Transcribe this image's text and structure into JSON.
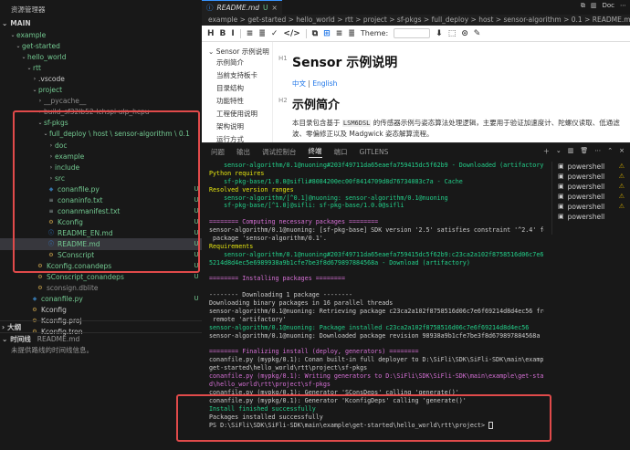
{
  "sidebar": {
    "title": "资源管理器",
    "root": "MAIN",
    "tree": [
      {
        "label": "example",
        "indent": 1,
        "chev": "down",
        "color": "green"
      },
      {
        "label": "get-started",
        "indent": 2,
        "chev": "down",
        "color": "green"
      },
      {
        "label": "hello_world",
        "indent": 3,
        "chev": "down",
        "color": "green"
      },
      {
        "label": "rtt",
        "indent": 4,
        "chev": "down",
        "color": "green"
      },
      {
        "label": ".vscode",
        "indent": 5,
        "chev": "right",
        "color": "default"
      },
      {
        "label": "project",
        "indent": 5,
        "chev": "down",
        "color": "green"
      },
      {
        "label": "__pycache__",
        "indent": 6,
        "chev": "right",
        "color": "grey"
      },
      {
        "label": "build_sf32lb52-lchspi-ulp_hcpu",
        "indent": 6,
        "chev": "right",
        "color": "grey"
      },
      {
        "label": "sf-pkgs",
        "indent": 6,
        "chev": "down",
        "color": "green"
      },
      {
        "label": "full_deploy \\ host \\ sensor-algorithm \\ 0.1",
        "indent": 7,
        "chev": "down",
        "color": "green"
      },
      {
        "label": "doc",
        "indent": 8,
        "chev": "right",
        "color": "green"
      },
      {
        "label": "example",
        "indent": 8,
        "chev": "right",
        "color": "green"
      },
      {
        "label": "include",
        "indent": 8,
        "chev": "right",
        "color": "green"
      },
      {
        "label": "src",
        "indent": 8,
        "chev": "right",
        "color": "green"
      },
      {
        "label": "conanfile.py",
        "indent": 8,
        "icon": "py",
        "color": "green",
        "badge": "U"
      },
      {
        "label": "conaninfo.txt",
        "indent": 8,
        "icon": "txt",
        "color": "green",
        "badge": "U"
      },
      {
        "label": "conanmanifest.txt",
        "indent": 8,
        "icon": "txt",
        "color": "green",
        "badge": "U"
      },
      {
        "label": "Kconfig",
        "indent": 8,
        "icon": "cfg",
        "color": "green",
        "badge": "U"
      },
      {
        "label": "README_EN.md",
        "indent": 8,
        "icon": "md",
        "color": "green",
        "badge": "U"
      },
      {
        "label": "README.md",
        "indent": 8,
        "icon": "md",
        "color": "green",
        "badge": "U",
        "selected": true
      },
      {
        "label": "SConscript",
        "indent": 8,
        "icon": "cfg",
        "color": "green",
        "badge": "U"
      },
      {
        "label": "Kconfig.conandeps",
        "indent": 6,
        "icon": "cfg",
        "color": "green",
        "badge": "U"
      },
      {
        "label": "SConscript_conandeps",
        "indent": 6,
        "icon": "cfg",
        "color": "green",
        "badge": "U"
      },
      {
        "label": "sconsign.dblite",
        "indent": 6,
        "icon": "cfg",
        "color": "grey",
        "badge": ""
      },
      {
        "label": "conanfile.py",
        "indent": 5,
        "icon": "py",
        "color": "green",
        "badge": "U"
      },
      {
        "label": "Kconfig",
        "indent": 5,
        "icon": "cfg",
        "color": "default",
        "badge": ""
      },
      {
        "label": "Kconfig.proj",
        "indent": 5,
        "icon": "cfg",
        "color": "default",
        "badge": ""
      },
      {
        "label": "Kconfig.tron",
        "indent": 5,
        "icon": "cfg",
        "color": "default",
        "badge": ""
      }
    ],
    "outline_title": "大纲",
    "timeline_title": "时间线",
    "timeline_file": "README.md",
    "timeline_empty": "未提供路线的时间线信息。"
  },
  "tabs": [
    {
      "label": "README.md",
      "badge": "U"
    }
  ],
  "breadcrumb": "example > get-started > hello_world > rtt > project > sf-pkgs > full_deploy > host > sensor-algorithm > 0.1 > README.md",
  "tab_actions": {
    "doc_label": "Doc"
  },
  "md": {
    "toolbar_items": [
      "H",
      "B",
      "I",
      "≡",
      "≣",
      "✓",
      "</>",
      "⧉",
      "⊞",
      "≡",
      "≣",
      "⬇",
      "⬚",
      "⊙",
      "✎"
    ],
    "theme_label": "Theme:",
    "outline_root": "Sensor 示例说明",
    "outline_items": [
      "示例简介",
      "当前支持板卡",
      "目录结构",
      "功能特性",
      "工程使用说明",
      "架构说明",
      "运行方式"
    ],
    "h1": "Sensor 示例说明",
    "h1_mark": "H1",
    "link_cn": "中文",
    "link_sep": "|",
    "link_en": "English",
    "h2": "示例简介",
    "h2_mark": "H2",
    "para_prefix": "本目录包含基于 ",
    "para_code": "LSM6DSL",
    "para_rest": " 的传感器示例与姿态算法处理逻辑，主要用于验证加速度计、陀螺仪读取、低通滤波、零偏修正以及 Madgwick 姿态解算流程。"
  },
  "panel": {
    "tabs": [
      "问题",
      "输出",
      "调试控制台",
      "终端",
      "端口",
      "GITLENS"
    ],
    "active_tab": 3,
    "terminals": [
      "powershell",
      "powershell",
      "powershell",
      "powershell",
      "powershell",
      "powershell"
    ],
    "warnings": [
      true,
      true,
      true,
      true,
      true,
      false
    ]
  },
  "terminal_lines": [
    {
      "c": "green",
      "t": "    sensor-algorithm/0.1@nuoning#203f49711da65eaefa759415dc5f62b9 - Downloaded (artifactory)"
    },
    {
      "c": "yellow",
      "t": "Python requires"
    },
    {
      "c": "green",
      "t": "    sf-pkg-base/1.0.0@sifli#8084200ec00f8414709d8d76734083c7a - Cache"
    },
    {
      "c": "yellow",
      "t": "Resolved version ranges"
    },
    {
      "c": "green",
      "t": "    sensor-algorithm/[^0.1]@nuoning: sensor-algorithm/0.1@nuoning"
    },
    {
      "c": "green",
      "t": "    sf-pkg-base/[^1.0]@sifli: sf-pkg-base/1.0.0@sifli"
    },
    {
      "c": "",
      "t": ""
    },
    {
      "c": "magenta",
      "t": "======== Computing necessary packages ========"
    },
    {
      "c": "default",
      "t": "sensor-algorithm/0.1@nuoning: [sf-pkg-base] SDK version '2.5' satisfies constraint '^2.4' for"
    },
    {
      "c": "default",
      "t": " package 'sensor-algorithm/0.1'."
    },
    {
      "c": "yellow",
      "t": "Requirements"
    },
    {
      "c": "green",
      "t": "    sensor-algorithm/0.1@nuoning#203f49711da65eaefa759415dc5f62b9:c23ca2a102f8758516d06c7e6f69"
    },
    {
      "c": "green",
      "t": "5214d8d4ec5e6989938a9b1cfe7be3f8d679897884568a - Download (artifactory)"
    },
    {
      "c": "",
      "t": ""
    },
    {
      "c": "magenta",
      "t": "======== Installing packages ========"
    },
    {
      "c": "",
      "t": ""
    },
    {
      "c": "default",
      "t": "-------- Downloading 1 package --------"
    },
    {
      "c": "default",
      "t": "Downloading binary packages in 16 parallel threads"
    },
    {
      "c": "default",
      "t": "sensor-algorithm/0.1@nuoning: Retrieving package c23ca2a102f8758516d06c7e6f69214d8d4ec56 from"
    },
    {
      "c": "default",
      "t": " remote 'artifactory'"
    },
    {
      "c": "green",
      "t": "sensor-algorithm/0.1@nuoning: Package installed c23ca2a102f8758516d06c7e6f69214d8d4ec56"
    },
    {
      "c": "default",
      "t": "sensor-algorithm/0.1@nuoning: Downloaded package revision 98938a9b1cfe7be3f8d679897884568a"
    },
    {
      "c": "",
      "t": ""
    },
    {
      "c": "magenta",
      "t": "======== Finalizing install (deploy, generators) ========"
    },
    {
      "c": "default",
      "t": "conanfile.py (mypkg/0.1): Conan built-in full deployer to D:\\SiFli\\SDK\\SiFli-SDK\\main\\example\\"
    },
    {
      "c": "default",
      "t": "get-started\\hello_world\\rtt\\project\\sf-pkgs"
    },
    {
      "c": "magenta",
      "t": "conanfile.py (mypkg/0.1): Writing generators to D:\\SiFli\\SDK\\SiFli-SDK\\main\\example\\get-starte"
    },
    {
      "c": "magenta",
      "t": "d\\hello_world\\rtt\\project\\sf-pkgs"
    },
    {
      "c": "default",
      "t": "conanfile.py (mypkg/0.1): Generator 'SConsDeps' calling 'generate()'"
    },
    {
      "c": "default",
      "t": "conanfile.py (mypkg/0.1): Generator 'KconfigDeps' calling 'generate()'"
    },
    {
      "c": "green",
      "t": "Install finished successfully"
    },
    {
      "c": "default",
      "t": "Packages installed successfully"
    },
    {
      "c": "default",
      "t": "PS D:\\SiFli\\SDK\\SiFli-SDK\\main\\example\\get-started\\hello_world\\rtt\\project> "
    }
  ],
  "colors": {
    "accent": "#3794ff",
    "highlight_box": "#e04a4a",
    "git_untracked": "#73c991"
  }
}
